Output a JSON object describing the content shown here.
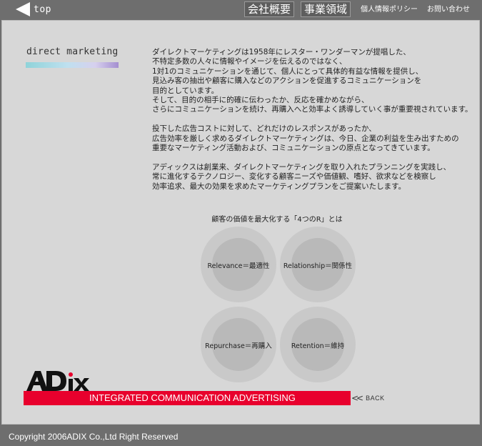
{
  "nav": {
    "top_label": "top",
    "company_overview": "会社概要",
    "business_areas": "事業領域",
    "privacy_policy": "個人情報ポリシー",
    "contact": "お問い合わせ"
  },
  "section": {
    "title": "direct marketing"
  },
  "body": {
    "paragraphs": [
      "ダイレクトマーケティングは1958年にレスター・ワンダーマンが提唱した、\n不特定多数の人々に情報やイメージを伝えるのではなく、\n1対1のコミュニケーションを通じて、個人にとって具体的有益な情報を提供し、\n見込み客の抽出や顧客に購入などのアクションを促進するコミュニケーションを\n目的としています。\nそして、目的の相手に的確に伝わったか、反応を確かめながら、\nさらにコミュニケーションを続け、再購入へと効率よく誘導していく事が重要視されています。",
      "投下した広告コストに対して、どれだけのレスポンスがあったか、\n広告効率を厳しく求めるダイレクトマーケティングは、今日、企業の利益を生み出すための\n重要なマーケティング活動および、コミュニケーションの原点となってきています。",
      "アディックスは創業来、ダイレクトマーケティングを取り入れたプランニングを実践し、\n常に進化するテクノロジー、変化する顧客ニーズや価値観、嗜好、欲求などを検察し\n効率追求、最大の効果を求めたマーケティングプランをご提案いたします。"
    ]
  },
  "four_r": {
    "heading": "顧客の価値を最大化する「4つのR」とは",
    "items": [
      "Relevance＝最適性",
      "Relationship＝関係性",
      "Repurchase＝再購入",
      "Retention＝維持"
    ]
  },
  "brand": {
    "logo_text": "ADiX",
    "tagline": "INTEGRATED COMMUNICATION ADVERTISING",
    "back_label": "BACK",
    "strip_color": "#e8002d"
  },
  "footer": {
    "copyright": "Copyright 2006ADIX Co.,Ltd Right Reserved"
  }
}
